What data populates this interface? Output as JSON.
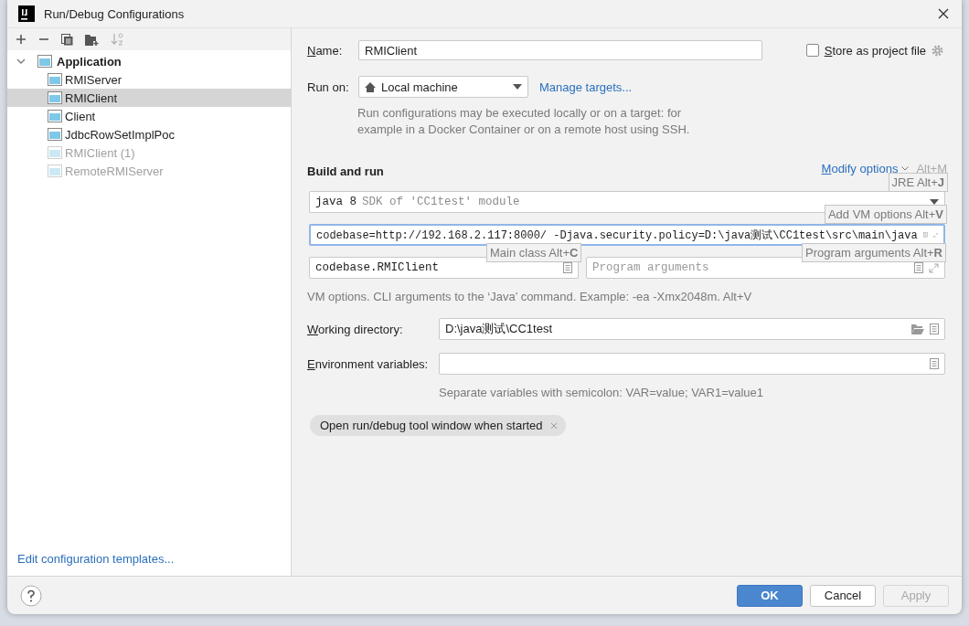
{
  "window": {
    "title": "Run/Debug Configurations"
  },
  "toolbar": [
    {
      "kind": "add",
      "disabled": false
    },
    {
      "kind": "remove",
      "disabled": false
    },
    {
      "kind": "copy",
      "disabled": false
    },
    {
      "kind": "folder",
      "disabled": false
    },
    {
      "kind": "sort",
      "disabled": true
    }
  ],
  "tree": [
    {
      "label": "Application",
      "expanded": true,
      "selected": false,
      "disabled": false,
      "children": [
        {
          "label": "RMIServer",
          "selected": false,
          "disabled": false
        },
        {
          "label": "RMIClient",
          "selected": true,
          "disabled": false
        },
        {
          "label": "Client",
          "selected": false,
          "disabled": false
        },
        {
          "label": "JdbcRowSetImplPoc",
          "selected": false,
          "disabled": false
        },
        {
          "label": "RMIClient (1)",
          "selected": false,
          "disabled": true
        },
        {
          "label": "RemoteRMIServer",
          "selected": false,
          "disabled": true
        }
      ]
    }
  ],
  "templates_link": "Edit configuration templates...",
  "name": {
    "label": "Name:",
    "mnemonic": true,
    "value": "RMIClient"
  },
  "store_as_project_file": {
    "label": "Store as project file",
    "mnemonic": true,
    "checked": false
  },
  "run_on": {
    "label": "Run on:",
    "value": "Local machine",
    "link": "Manage targets...",
    "hint": "Run configurations may be executed locally or on a target: for example in a Docker Container or on a remote host using SSH."
  },
  "build_and_run": {
    "title": "Build and run",
    "modify_options": "Modify options",
    "modify_shortcut": "Alt+M",
    "jre": {
      "value": "java 8",
      "detail": "SDK of 'CC1test' module",
      "tooltip": "JRE Alt+**J**"
    },
    "vm_options": {
      "value": "codebase=http://192.168.2.117:8000/ -Djava.security.policy=D:\\java测试\\CC1test\\src\\main\\java",
      "focused": true,
      "tooltip": "Add VM options Alt+**V**"
    },
    "main_class": {
      "value": "codebase.RMIClient",
      "tooltip": "Main class Alt+**C**"
    },
    "program_arguments": {
      "placeholder": "Program arguments",
      "tooltip": "Program arguments Alt+**R**"
    },
    "hint": "VM options. CLI arguments to the ‘Java’ command. Example: -ea -Xmx2048m. Alt+V"
  },
  "working_directory": {
    "label": "Working directory:",
    "mnemonic": true,
    "value": "D:\\java测试\\CC1test"
  },
  "environment_variables": {
    "label": "Environment variables:",
    "mnemonic": true,
    "hint": "Separate variables with semicolon: VAR=value; VAR1=value1"
  },
  "chips": [
    {
      "label": "Open run/debug tool window when started"
    }
  ],
  "buttons": [
    {
      "label": "OK",
      "kind": "primary",
      "disabled": false
    },
    {
      "label": "Cancel",
      "kind": "normal",
      "disabled": false
    },
    {
      "label": "Apply",
      "kind": "normal",
      "disabled": true
    }
  ]
}
